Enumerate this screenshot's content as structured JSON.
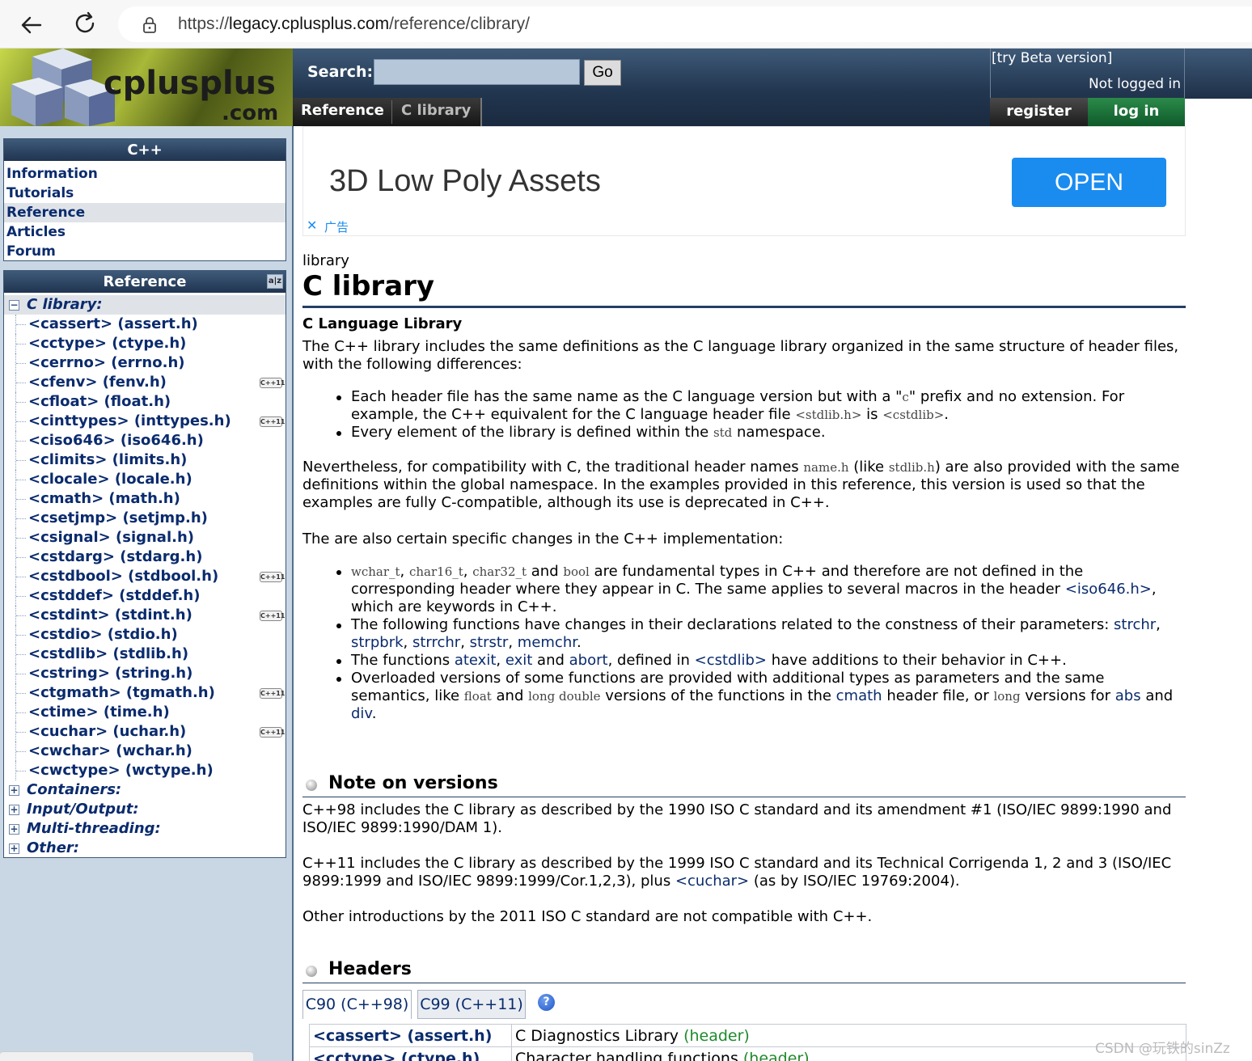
{
  "browser": {
    "url_prefix": "https://",
    "url_host": "legacy.cplusplus.com",
    "url_path": "/reference/clibrary/"
  },
  "header": {
    "logo_text": "cplusplus",
    "logo_suffix": ".com",
    "search_label": "Search:",
    "search_value": "",
    "go_label": "Go",
    "beta_link": "[try Beta version]",
    "login_status": "Not logged in",
    "register_label": "register",
    "login_label": "log in",
    "breadcrumb": [
      "Reference",
      "C library"
    ]
  },
  "sidebar": {
    "cpp_title": "C++",
    "cpp_items": [
      "Information",
      "Tutorials",
      "Reference",
      "Articles",
      "Forum"
    ],
    "reference_title": "Reference",
    "az_label": "a|z",
    "c_library_label": "C library:",
    "headers": [
      {
        "label": "<cassert> (assert.h)",
        "cpp11": false
      },
      {
        "label": "<cctype> (ctype.h)",
        "cpp11": false
      },
      {
        "label": "<cerrno> (errno.h)",
        "cpp11": false
      },
      {
        "label": "<cfenv> (fenv.h)",
        "cpp11": true
      },
      {
        "label": "<cfloat> (float.h)",
        "cpp11": false
      },
      {
        "label": "<cinttypes> (inttypes.h)",
        "cpp11": true
      },
      {
        "label": "<ciso646> (iso646.h)",
        "cpp11": false
      },
      {
        "label": "<climits> (limits.h)",
        "cpp11": false
      },
      {
        "label": "<clocale> (locale.h)",
        "cpp11": false
      },
      {
        "label": "<cmath> (math.h)",
        "cpp11": false
      },
      {
        "label": "<csetjmp> (setjmp.h)",
        "cpp11": false
      },
      {
        "label": "<csignal> (signal.h)",
        "cpp11": false
      },
      {
        "label": "<cstdarg> (stdarg.h)",
        "cpp11": false
      },
      {
        "label": "<cstdbool> (stdbool.h)",
        "cpp11": true
      },
      {
        "label": "<cstddef> (stddef.h)",
        "cpp11": false
      },
      {
        "label": "<cstdint> (stdint.h)",
        "cpp11": true
      },
      {
        "label": "<cstdio> (stdio.h)",
        "cpp11": false
      },
      {
        "label": "<cstdlib> (stdlib.h)",
        "cpp11": false
      },
      {
        "label": "<cstring> (string.h)",
        "cpp11": false
      },
      {
        "label": "<ctgmath> (tgmath.h)",
        "cpp11": true
      },
      {
        "label": "<ctime> (time.h)",
        "cpp11": false
      },
      {
        "label": "<cuchar> (uchar.h)",
        "cpp11": true
      },
      {
        "label": "<cwchar> (wchar.h)",
        "cpp11": false
      },
      {
        "label": "<cwctype> (wctype.h)",
        "cpp11": false
      }
    ],
    "cpp11_badge": "C++11",
    "categories": [
      "Containers:",
      "Input/Output:",
      "Multi-threading:",
      "Other:"
    ]
  },
  "ad": {
    "title": "3D Low Poly Assets",
    "button": "OPEN",
    "close": "✕",
    "label": "广告"
  },
  "main": {
    "kind": "library",
    "title": "C library",
    "subtitle": "C Language Library",
    "intro": "The C++ library includes the same definitions as the C language library organized in the same structure of header files, with the following differences:",
    "diff1_a": "Each header file has the same name as the C language version but with a \"",
    "diff1_code_c": "c",
    "diff1_b": "\" prefix and no extension. For example, the C++ equivalent for the C language header file ",
    "diff1_code_stdlib": "<stdlib.h>",
    "diff1_c": " is ",
    "diff1_code_cstdlib": "<cstdlib>",
    "diff1_d": ".",
    "diff2_a": "Every element of the library is defined within the ",
    "diff2_code": "std",
    "diff2_b": " namespace.",
    "compat_a": "Nevertheless, for compatibility with C, the traditional header names ",
    "compat_code1": "name.h",
    "compat_b": " (like ",
    "compat_code2": "stdlib.h",
    "compat_c": ") are also provided with the same definitions within the global namespace. In the examples provided in this reference, this version is used so that the examples are fully C-compatible, although its use is deprecated in C++.",
    "changes_intro": "The are also certain specific changes in the C++ implementation:",
    "ch1_code1": "wchar_t",
    "ch1_sep1": ", ",
    "ch1_code2": "char16_t",
    "ch1_sep2": ", ",
    "ch1_code3": "char32_t",
    "ch1_and": " and ",
    "ch1_code4": "bool",
    "ch1_text": " are fundamental types in C++ and therefore are not defined in the corresponding header where they appear in C. The same applies to several macros in the header ",
    "ch1_link": "<iso646.h>",
    "ch1_end": ", which are keywords in C++.",
    "ch2_text": "The following functions have changes in their declarations related to the constness of their parameters: ",
    "ch2_l1": "strchr",
    "ch2_l2": "strpbrk",
    "ch2_l3": "strrchr",
    "ch2_l4": "strstr",
    "ch2_l5": "memchr",
    "comma": ", ",
    "period": ".",
    "ch3_a": "The functions ",
    "ch3_l1": "atexit",
    "ch3_l2": "exit",
    "ch3_and": " and ",
    "ch3_l3": "abort",
    "ch3_b": ", defined in ",
    "ch3_l4": "<cstdlib>",
    "ch3_c": " have additions to their behavior in C++.",
    "ch4_a": "Overloaded versions of some functions are provided with additional types as parameters and the same semantics, like ",
    "ch4_code1": "float",
    "ch4_and": " and ",
    "ch4_code2": "long double",
    "ch4_b": " versions of the functions in the ",
    "ch4_l1": "cmath",
    "ch4_c": " header file, or ",
    "ch4_code3": "long",
    "ch4_d": " versions for ",
    "ch4_l2": "abs",
    "ch4_e": " and ",
    "ch4_l3": "div",
    "ch4_f": ".",
    "versions_title": "Note on versions",
    "v98": "C++98 includes the C library as described by the 1990 ISO C standard and its amendment #1 (ISO/IEC 9899:1990 and ISO/IEC 9899:1990/DAM 1).",
    "v11_a": "C++11 includes the C library as described by the 1999 ISO C standard and its Technical Corrigenda 1, 2 and 3 (ISO/IEC 9899:1999 and ISO/IEC 9899:1999/Cor.1,2,3), plus ",
    "v11_link": "<cuchar>",
    "v11_b": " (as by ISO/IEC 19769:2004).",
    "v_other": "Other introductions by the 2011 ISO C standard are not compatible with C++.",
    "headers_title": "Headers",
    "tab1": "C90 (C++98)",
    "tab2": "C99 (C++11)",
    "help": "?",
    "table": [
      {
        "name": "<cassert> (assert.h)",
        "desc": "C Diagnostics Library ",
        "tag": "(header)"
      },
      {
        "name": "<cctype> (ctype.h)",
        "desc": "Character handling functions ",
        "tag": "(header)"
      }
    ]
  },
  "watermark": "CSDN @玩铁的sinZz"
}
